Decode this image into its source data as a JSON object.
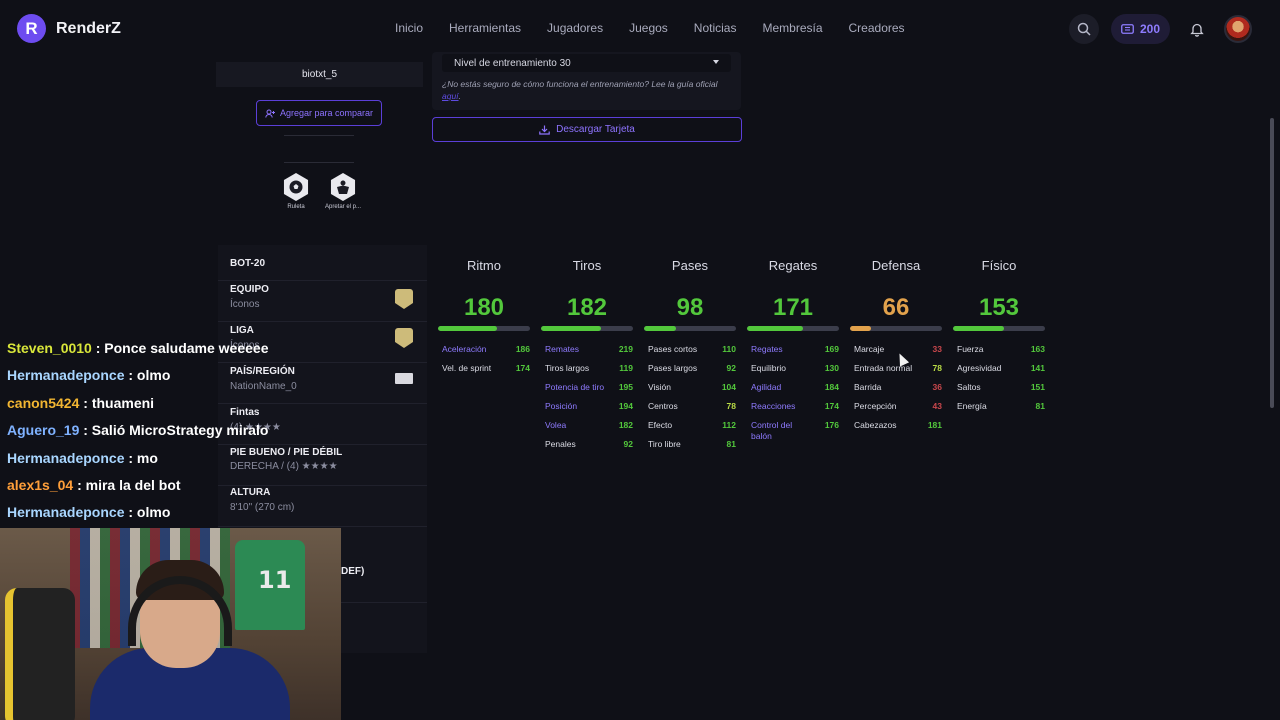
{
  "nav": {
    "brand": "RenderZ",
    "brand_letter": "R",
    "links": [
      "Inicio",
      "Herramientas",
      "Jugadores",
      "Juegos",
      "Noticias",
      "Membresía",
      "Creadores"
    ],
    "coins": "200"
  },
  "player": {
    "name": "biotxt_5",
    "compare_label": "Agregar para comparar",
    "playstyles": [
      "Ruleta",
      "Apretar el p..."
    ]
  },
  "training": {
    "selected": "Nivel de entrenamiento 30",
    "note": "¿No estás seguro de cómo funciona el entrenamiento? Lee la guía oficial ",
    "note_link": "aquí",
    "note_end": ".",
    "download_label": "Descargar Tarjeta"
  },
  "info": {
    "header": "BOT-20",
    "rows": [
      {
        "title": "EQUIPO",
        "sub": "Íconos"
      },
      {
        "title": "LIGA",
        "sub": "Íconos"
      },
      {
        "title": "PAÍS/REGIÓN",
        "sub": "NationName_0"
      },
      {
        "title": "Fintas",
        "sub": "(4) ★★★★"
      },
      {
        "title": "PIE BUENO / PIE DÉBIL",
        "sub": "DERECHA / (4) ★★★★"
      },
      {
        "title": "ALTURA",
        "sub": "8'10\" (270 cm)"
      }
    ],
    "partial": "DEF)"
  },
  "stats": [
    {
      "name": "Ritmo",
      "value": "180",
      "color": "green",
      "fill": 0.64,
      "subs": [
        {
          "n": "Aceleración",
          "v": "186",
          "accent": true,
          "c": "green"
        },
        {
          "n": "Vel. de sprint",
          "v": "174",
          "accent": false,
          "c": "green"
        }
      ]
    },
    {
      "name": "Tiros",
      "value": "182",
      "color": "green",
      "fill": 0.65,
      "subs": [
        {
          "n": "Remates",
          "v": "219",
          "accent": true,
          "c": "green"
        },
        {
          "n": "Tiros largos",
          "v": "119",
          "accent": false,
          "c": "green"
        },
        {
          "n": "Potencia de tiro",
          "v": "195",
          "accent": true,
          "c": "green"
        },
        {
          "n": "Posición",
          "v": "194",
          "accent": true,
          "c": "green"
        },
        {
          "n": "Volea",
          "v": "182",
          "accent": true,
          "c": "green"
        },
        {
          "n": "Penales",
          "v": "92",
          "accent": false,
          "c": "green"
        }
      ]
    },
    {
      "name": "Pases",
      "value": "98",
      "color": "green",
      "fill": 0.35,
      "subs": [
        {
          "n": "Pases cortos",
          "v": "110",
          "accent": false,
          "c": "green"
        },
        {
          "n": "Pases largos",
          "v": "92",
          "accent": false,
          "c": "green"
        },
        {
          "n": "Visión",
          "v": "104",
          "accent": false,
          "c": "green"
        },
        {
          "n": "Centros",
          "v": "78",
          "accent": false,
          "c": "yellowgreen"
        },
        {
          "n": "Efecto",
          "v": "112",
          "accent": false,
          "c": "green"
        },
        {
          "n": "Tiro libre",
          "v": "81",
          "accent": false,
          "c": "green"
        }
      ]
    },
    {
      "name": "Regates",
      "value": "171",
      "color": "green",
      "fill": 0.61,
      "subs": [
        {
          "n": "Regates",
          "v": "169",
          "accent": true,
          "c": "green"
        },
        {
          "n": "Equilibrio",
          "v": "130",
          "accent": false,
          "c": "green"
        },
        {
          "n": "Agilidad",
          "v": "184",
          "accent": true,
          "c": "green"
        },
        {
          "n": "Reacciones",
          "v": "174",
          "accent": true,
          "c": "green"
        },
        {
          "n": "Control del balón",
          "v": "176",
          "accent": true,
          "c": "green"
        }
      ]
    },
    {
      "name": "Defensa",
      "value": "66",
      "color": "orange",
      "fill": 0.23,
      "subs": [
        {
          "n": "Marcaje",
          "v": "33",
          "accent": false,
          "c": "red"
        },
        {
          "n": "Entrada normal",
          "v": "78",
          "accent": false,
          "c": "yellowgreen"
        },
        {
          "n": "Barrida",
          "v": "36",
          "accent": false,
          "c": "red"
        },
        {
          "n": "Percepción",
          "v": "43",
          "accent": false,
          "c": "red"
        },
        {
          "n": "Cabezazos",
          "v": "181",
          "accent": false,
          "c": "green"
        }
      ]
    },
    {
      "name": "Físico",
      "value": "153",
      "color": "green",
      "fill": 0.55,
      "subs": [
        {
          "n": "Fuerza",
          "v": "163",
          "accent": false,
          "c": "green"
        },
        {
          "n": "Agresividad",
          "v": "141",
          "accent": false,
          "c": "green"
        },
        {
          "n": "Saltos",
          "v": "151",
          "accent": false,
          "c": "green"
        },
        {
          "n": "Energía",
          "v": "81",
          "accent": false,
          "c": "green"
        }
      ]
    }
  ],
  "colors": {
    "green": "#53c83c",
    "orange": "#e2a24c",
    "accent": "#6d4cf0"
  },
  "chat": [
    {
      "user": "Steven_0010",
      "msg": ": Ponce saludame weeeee",
      "color": "#d8e63a"
    },
    {
      "user": "Hermanadeponce",
      "msg": ": olmo",
      "color": "#a9d6ff"
    },
    {
      "user": "canon5424",
      "msg": ": thuameni",
      "color": "#f2b632"
    },
    {
      "user": "Aguero_19",
      "msg": ": Salió MicroStrategy miralo",
      "color": "#7fb2ff"
    },
    {
      "user": "Hermanadeponce",
      "msg": ": mo",
      "color": "#a9d6ff"
    },
    {
      "user": "alex1s_04",
      "msg": ": mira la del bot",
      "color": "#ff9f3a"
    },
    {
      "user": "Hermanadeponce",
      "msg": ": olmo",
      "color": "#a9d6ff"
    }
  ],
  "webcam": {
    "shirt_number": "11"
  }
}
